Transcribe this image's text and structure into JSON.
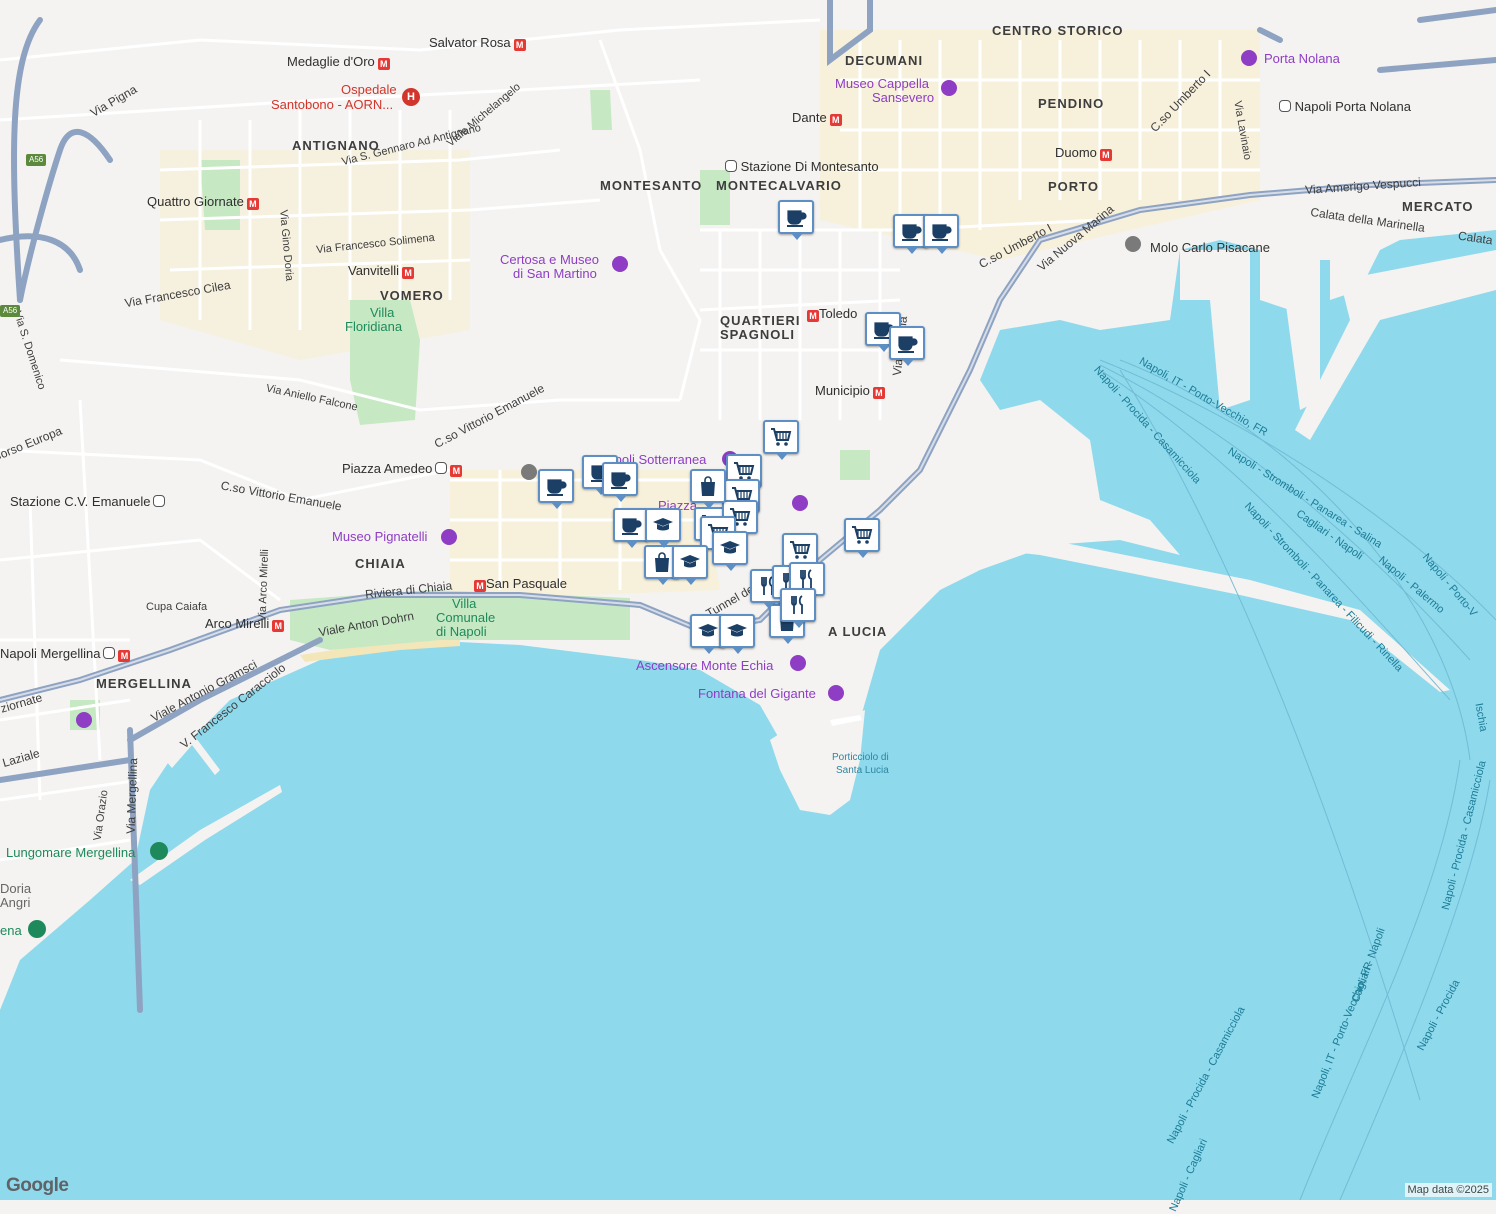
{
  "map": {
    "attribution": "Map data ©2025",
    "logo": "Google",
    "water_color": "#8fd9ec",
    "land_color": "#f4f3f1",
    "park_color": "#c6e9c4",
    "road_color": "#8ea3c2"
  },
  "areas": {
    "centro_storico": "CENTRO STORICO",
    "decumani": "DECUMANI",
    "pendino": "PENDINO",
    "porto": "PORTO",
    "mercato": "MERCATO",
    "antignano": "ANTIGNANO",
    "montesanto": "MONTESANTO",
    "montecalvario": "MONTECALVARIO",
    "vomero": "VOMERO",
    "quartieri_1": "QUARTIERI",
    "quartieri_2": "SPAGNOLI",
    "chiaia": "CHIAIA",
    "mergellina": "MERGELLINA",
    "santa_lucia": "A LUCIA"
  },
  "streets": {
    "via_pigna": "Via Pigna",
    "gennaro": "Via S. Gennaro Ad Antignano",
    "michelangelo": "Viale Michelangelo",
    "gino_doria": "Via Gino Doria",
    "solimena": "Via Francesco Solimena",
    "cilea": "Via Francesco Cilea",
    "domenico": "Via S. Domenico",
    "corso_europa": "Corso Europa",
    "falcone": "Via Aniello Falcone",
    "vittorio_1": "C.so Vittorio Emanuele",
    "vittorio_2": "C.so Vittorio Emanuele",
    "arco_mirelli": "Via Arco Mirelli",
    "cupa_caiafa": "Cupa Caiafa",
    "riviera": "Riviera di Chiaia",
    "anton_dohrn": "Viale Anton Dohrn",
    "gramsci": "Viale Antonio Gramsci",
    "caracciolo": "V. Francesco Caracciolo",
    "laziale": "Laziale",
    "giornate": "ziornate",
    "mergellina_via": "Via Mergellina",
    "orazio": "Via Orazio",
    "tunnel": "Tunnel della Vittoria",
    "medina": "Via Medina",
    "umberto_1": "C.so Umberto I",
    "umberto_2": "C.so Umberto I",
    "nuova_marina": "Via Nuova Marina",
    "vespucci": "Via Amerigo Vespucci",
    "marinella": "Calata della Marinella",
    "calata": "Calata",
    "lavinaio": "Via Lavinaio"
  },
  "stations": {
    "salvator_rosa": "Salvator Rosa",
    "medaglie": "Medaglie d'Oro",
    "quattro_giornate": "Quattro Giornate",
    "vanvitelli": "Vanvitelli",
    "dante": "Dante",
    "toledo": "Toledo",
    "municipio": "Municipio",
    "duomo": "Duomo",
    "piazza_amedeo": "Piazza Amedeo",
    "san_pasquale": "San Pasquale",
    "arco_mirelli": "Arco Mirelli",
    "napoli_mergellina": "Napoli Mergellina",
    "montesanto": "Stazione Di Montesanto",
    "cv_emanuele": "Stazione C.V. Emanuele",
    "porta_nolana_st": "Napoli Porta Nolana"
  },
  "pois": {
    "ospedale_1": "Ospedale",
    "ospedale_2": "Santobono - AORN...",
    "museo_sansevero_1": "Museo Cappella",
    "museo_sansevero_2": "Sansevero",
    "certosa_1": "Certosa e Museo",
    "certosa_2": "di San Martino",
    "porta_nolana": "Porta Nolana",
    "villa_floridiana_1": "Villa",
    "villa_floridiana_2": "Floridiana",
    "sotterranea": "Napoli Sotterranea",
    "piazza": "Piazza",
    "museo_pignatelli": "Museo Pignatelli",
    "villa_comunale_1": "Villa",
    "villa_comunale_2": "Comunale",
    "villa_comunale_3": "di Napoli",
    "ascensore": "Ascensore Monte Echia",
    "fontana": "Fontana del Gigante",
    "molo": "Molo Carlo Pisacane",
    "lungomare": "Lungomare Mergellina",
    "doria_1": "Doria",
    "doria_2": "Angri",
    "ena": "ena",
    "porticciolo_1": "Porticciolo di",
    "porticciolo_2": "Santa Lucia"
  },
  "ferries": {
    "f1": "Napoli, IT - Porto-Vecchio, FR",
    "f2": "Napoli - Procida - Casamicciola",
    "f3": "Napoli - Stromboli - Panarea - Salina",
    "f4": "Cagliari - Napoli",
    "f5": "Napoli - Palermo",
    "f6": "Napoli - Stromboli - Panarea - Filicudi - Rinella",
    "f7": "Napoli - Porto-V",
    "f8": "Napoli - Procida - Casamicciola",
    "f9": "Cagliari - Napoli",
    "f10": "Napoli, IT - Porto-Vecchio, FR",
    "f11": "Napoli - Procida",
    "f12": "Napoli - Procida - Casamicciola",
    "f13": "Napoli - Cagliari",
    "f14": "Ischia"
  },
  "highways": {
    "a56": "A56",
    "a56b": "A56"
  },
  "markers": [
    {
      "type": "cafe"
    },
    {
      "type": "cafe"
    },
    {
      "type": "cafe"
    },
    {
      "type": "cafe"
    },
    {
      "type": "cafe"
    },
    {
      "type": "cafe"
    },
    {
      "type": "cafe"
    },
    {
      "type": "cafe"
    },
    {
      "type": "cafe"
    },
    {
      "type": "shop"
    },
    {
      "type": "shop"
    },
    {
      "type": "shop"
    },
    {
      "type": "shop"
    },
    {
      "type": "shop"
    },
    {
      "type": "shop"
    },
    {
      "type": "shop"
    },
    {
      "type": "shop"
    },
    {
      "type": "bag"
    },
    {
      "type": "bag"
    },
    {
      "type": "bag"
    },
    {
      "type": "school"
    },
    {
      "type": "school"
    },
    {
      "type": "school"
    },
    {
      "type": "school"
    },
    {
      "type": "school"
    },
    {
      "type": "food"
    },
    {
      "type": "food"
    },
    {
      "type": "food"
    },
    {
      "type": "food"
    }
  ]
}
